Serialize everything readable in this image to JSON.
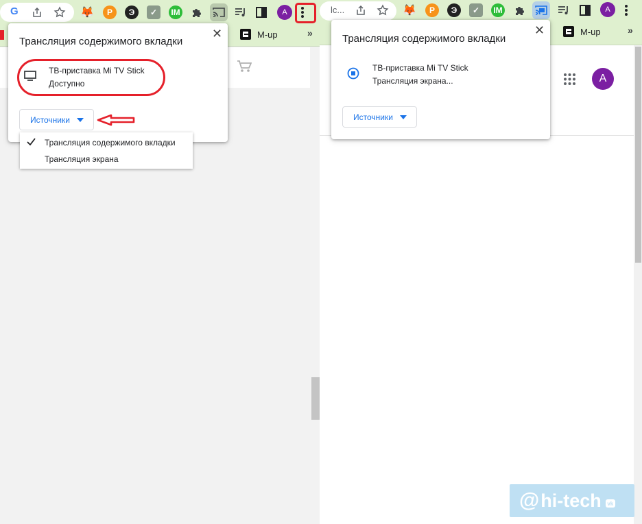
{
  "left": {
    "bookmark_label": "M-up",
    "avatar_letter": "A",
    "popup": {
      "title": "Трансляция содержимого вкладки",
      "close_symbol": "✕",
      "device_name": "ТВ-приставка Mi TV Stick",
      "device_status": "Доступно",
      "sources_button": "Источники"
    },
    "sources_menu": {
      "items": [
        {
          "label": "Трансляция содержимого вкладки",
          "checked": true
        },
        {
          "label": "Трансляция экрана",
          "checked": false
        }
      ]
    },
    "annotation_color": "#e5202a"
  },
  "right": {
    "tab_fragment": "lc...",
    "bookmark_label": "M-up",
    "avatar_letter": "A",
    "popup": {
      "title": "Трансляция содержимого вкладки",
      "close_symbol": "✕",
      "device_name": "ТВ-приставка Mi TV Stick",
      "device_status": "Трансляция экрана...",
      "sources_button": "Источники"
    },
    "page_avatar_letter": "A"
  },
  "watermark": {
    "at": "@",
    "text": "hi-tech",
    "badge": "vk"
  },
  "colors": {
    "toolbar_bg": "#dff0cf",
    "link_blue": "#1a73e8",
    "avatar_purple": "#7b1fa2"
  }
}
